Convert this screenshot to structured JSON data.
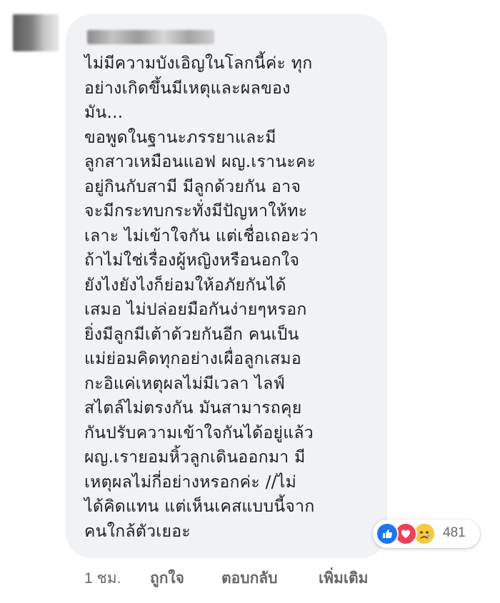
{
  "comment": {
    "author": "",
    "lines": [
      "ไม่มีความบังเอิญในโลกนี้ค่ะ ทุก",
      "อย่างเกิดขึ้นมีเหตุและผลของ",
      "มัน...",
      "ขอพูดในฐานะภรรยาและมี",
      "ลูกสาวเหมือนแอฟ ผญ.เรานะคะ",
      "อยู่กินกับสามี มีลูกด้วยกัน อาจ",
      "จะมีกระทบกระทั่งมีปัญหาให้ทะ",
      "เลาะ ไม่เข้าใจกัน แต่เชื่อเถอะว่า",
      "ถ้าไม่ใช่เรื่องผู้หญิงหรือนอกใจ",
      "ยังไงยังไงก็ย่อมให้อภัยกันได้",
      "เสมอ ไม่ปล่อยมือกันง่ายๆหรอก",
      "ยิ่งมีลูกมีเต้าด้วยกันอีก คนเป็น",
      "แม่ย่อมคิดทุกอย่างเผื่อลูกเสมอ",
      "กะอิแค่เหตุผลไม่มีเวลา ไลฟ์",
      "สไตล์ไม่ตรงกัน มันสามารถคุย",
      "กันปรับความเข้าใจกันได้อยู่แล้ว",
      "ผญ.เรายอมหิ้วลูกเดินออกมา มี",
      "เหตุผลไม่กี่อย่างหรอกค่ะ //ไม่",
      "ได้คิดแทน แต่เห็นเคสแบบนี้จาก",
      "คนใกล้ตัวเยอะ"
    ]
  },
  "reactions": {
    "icons": [
      "like-icon",
      "love-icon",
      "sad-icon"
    ],
    "count": "481",
    "colors": {
      "like": "#1877f2",
      "love": "#f33e58",
      "sad": "#f7c93c"
    }
  },
  "actions": {
    "time": "1 ชม.",
    "like": "ถูกใจ",
    "reply": "ตอบกลับ",
    "more": "เพิ่มเติม"
  }
}
